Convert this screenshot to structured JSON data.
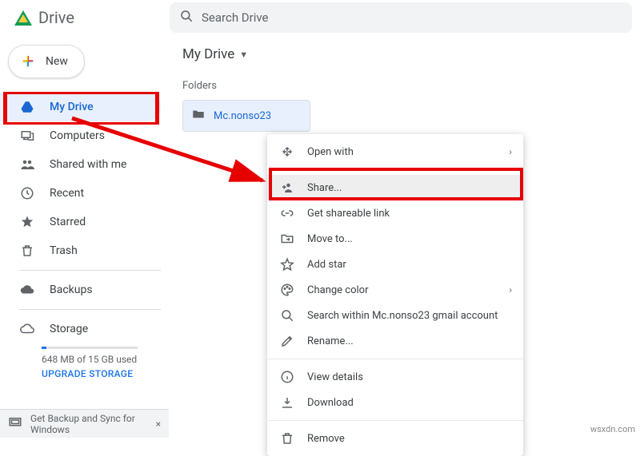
{
  "app": {
    "name": "Drive",
    "search_placeholder": "Search Drive"
  },
  "sidebar": {
    "new_label": "New",
    "items": [
      {
        "label": "My Drive"
      },
      {
        "label": "Computers"
      },
      {
        "label": "Shared with me"
      },
      {
        "label": "Recent"
      },
      {
        "label": "Starred"
      },
      {
        "label": "Trash"
      }
    ],
    "backups_label": "Backups",
    "storage_label": "Storage",
    "storage_used": "648 MB of 15 GB used",
    "upgrade_label": "UPGRADE STORAGE"
  },
  "banner": {
    "text": "Get Backup and Sync for Windows"
  },
  "main": {
    "breadcrumb": "My Drive",
    "section": "Folders",
    "folder_name": "Mc.nonso23"
  },
  "context_menu": {
    "open_with": "Open with",
    "share": "Share...",
    "link": "Get shareable link",
    "move": "Move to...",
    "star": "Add star",
    "color": "Change color",
    "search_within": "Search within Mc.nonso23 gmail account",
    "rename": "Rename...",
    "details": "View details",
    "download": "Download",
    "remove": "Remove"
  },
  "watermark": "wsxdn.com"
}
